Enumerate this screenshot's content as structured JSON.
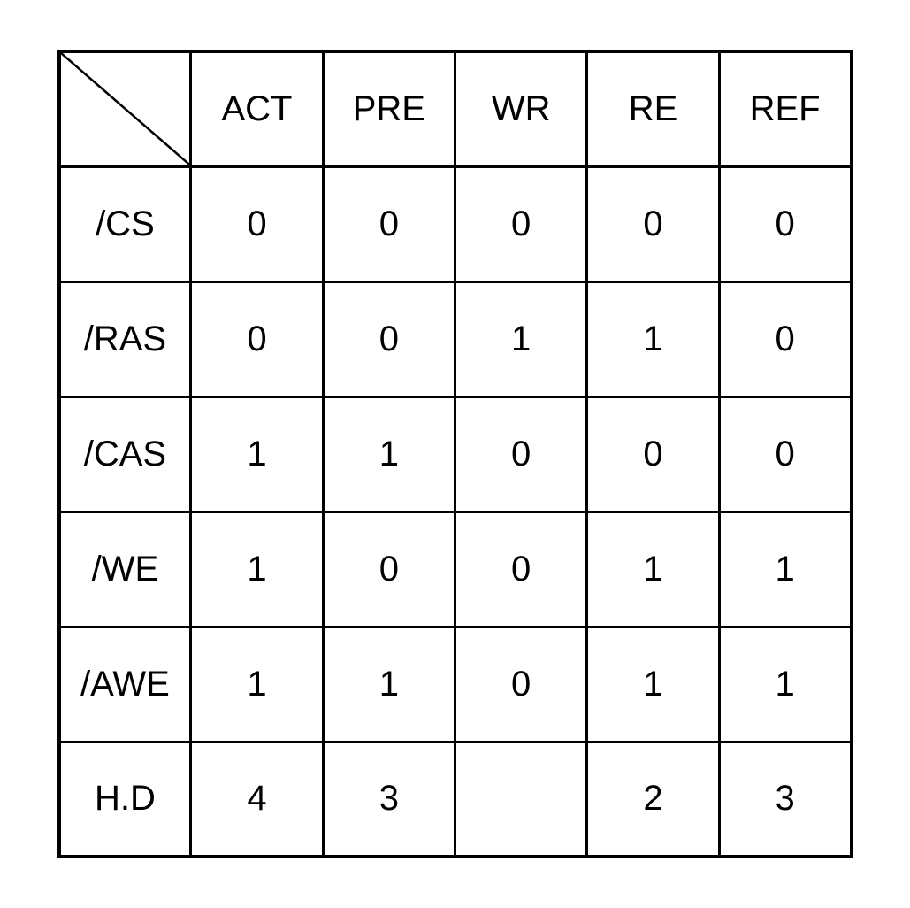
{
  "chart_data": {
    "type": "table",
    "columns": [
      "ACT",
      "PRE",
      "WR",
      "RE",
      "REF"
    ],
    "rows": [
      "/CS",
      "/RAS",
      "/CAS",
      "/WE",
      "/AWE",
      "H.D"
    ],
    "values": [
      [
        "0",
        "0",
        "0",
        "0",
        "0"
      ],
      [
        "0",
        "0",
        "1",
        "1",
        "0"
      ],
      [
        "1",
        "1",
        "0",
        "0",
        "0"
      ],
      [
        "1",
        "0",
        "0",
        "1",
        "1"
      ],
      [
        "1",
        "1",
        "0",
        "1",
        "1"
      ],
      [
        "4",
        "3",
        "",
        "2",
        "3"
      ]
    ]
  }
}
